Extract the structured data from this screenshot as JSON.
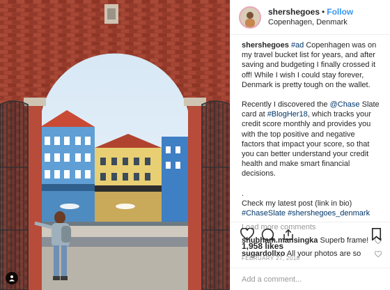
{
  "post": {
    "username": "shershegoes",
    "follow_label": "Follow",
    "separator": "•",
    "location": "Copenhagen, Denmark"
  },
  "caption": {
    "username": "shershegoes",
    "p1_tag": "#ad",
    "p1_text": " Copenhagen was on my travel bucket list for years, and after saving and budgeting I finally crossed it off! While I wish I could stay forever, Denmark is pretty tough on the wallet.",
    "p2_a": "Recently I discovered the ",
    "p2_mention": "@Chase",
    "p2_b": " Slate card at ",
    "p2_tag": "#BlogHer18",
    "p2_c": ", which tracks your credit score monthly and provides you with the top positive and negative factors that impact your score, so that you can better understand your credit health and make smart financial decisions.",
    "p3_dot": ".",
    "p3_text": "Check my latest post (link in bio)",
    "p3_tag1": "#ChaseSlate",
    "p3_tag2": "#shershegoes_denmark"
  },
  "load_more": "Load more comments",
  "comments": [
    {
      "user": "shubham.mansingka",
      "text": "Superb frame!"
    },
    {
      "user": "sugardollxo",
      "text": "All your photos are so"
    }
  ],
  "likes": "1,958 likes",
  "date": "FEBRUARY 27, 2018",
  "add_comment": {
    "placeholder": "Add a comment..."
  },
  "icons": [
    "heart-icon",
    "comment-icon",
    "share-icon",
    "bookmark-icon",
    "tag-user-icon"
  ],
  "colors": {
    "link": "#003569",
    "follow": "#3897f0",
    "muted": "#999999"
  }
}
